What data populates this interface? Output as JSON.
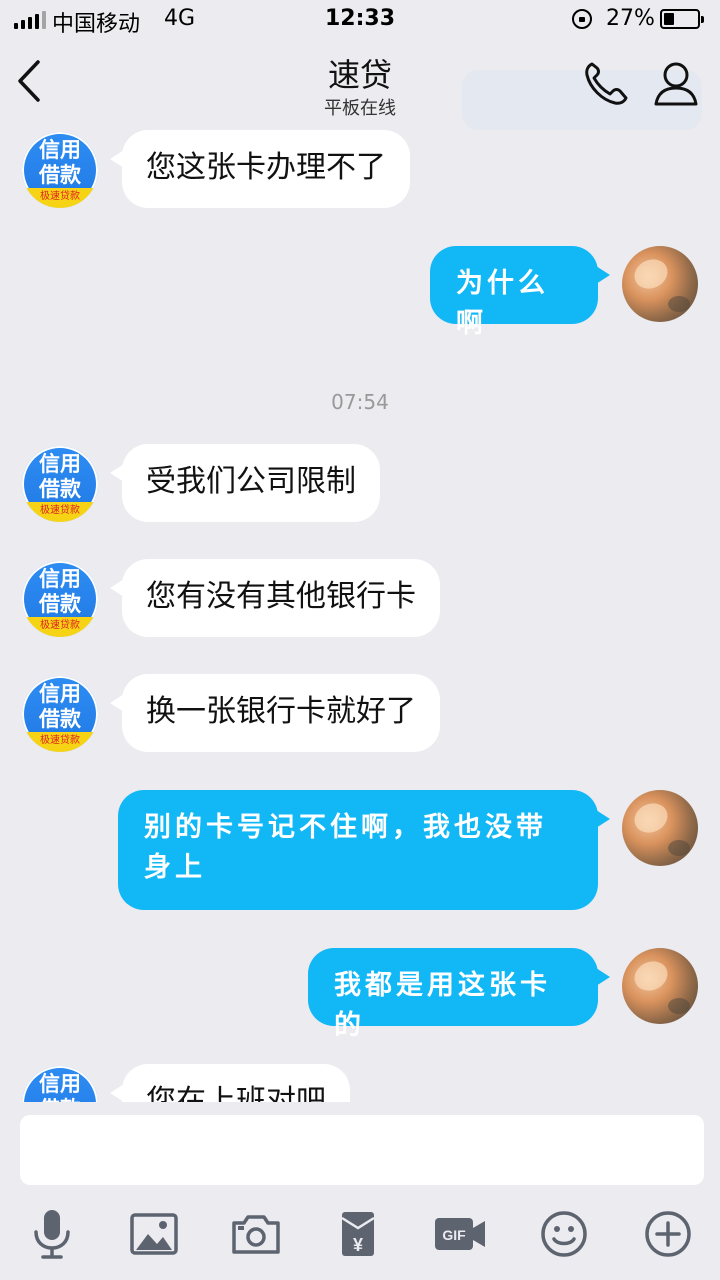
{
  "status_bar": {
    "carrier": "中国移动",
    "network": "4G",
    "time": "12:33",
    "battery_percent": "27%",
    "battery_level": 0.27
  },
  "nav": {
    "back_icon": "chevron-left-icon",
    "title": "速贷",
    "subtitle": "平板在线",
    "call_icon": "phone-icon",
    "profile_icon": "person-icon"
  },
  "avatars": {
    "credit": {
      "line1": "信用",
      "line2": "借款",
      "band": "极速贷款"
    }
  },
  "messages": [
    {
      "side": "in",
      "text": "您这张卡办理不了"
    },
    {
      "side": "out",
      "text": "为什么啊"
    },
    {
      "side": "time",
      "text": "07:54"
    },
    {
      "side": "in",
      "text": "受我们公司限制"
    },
    {
      "side": "in",
      "text": "您有没有其他银行卡"
    },
    {
      "side": "in",
      "text": "换一张银行卡就好了"
    },
    {
      "side": "out",
      "text": "别的卡号记不住啊，我也没带身上"
    },
    {
      "side": "out",
      "text": "我都是用这张卡的"
    },
    {
      "side": "in",
      "text": "您在上班对吧"
    }
  ],
  "input": {
    "value": "",
    "placeholder": ""
  },
  "toolbar": [
    "microphone-icon",
    "image-icon",
    "camera-icon",
    "red-packet-icon",
    "gif-icon",
    "emoji-icon",
    "plus-icon"
  ],
  "colors": {
    "outgoing_bubble": "#12b7f5",
    "incoming_bubble": "#ffffff",
    "background": "#ebebf0"
  }
}
